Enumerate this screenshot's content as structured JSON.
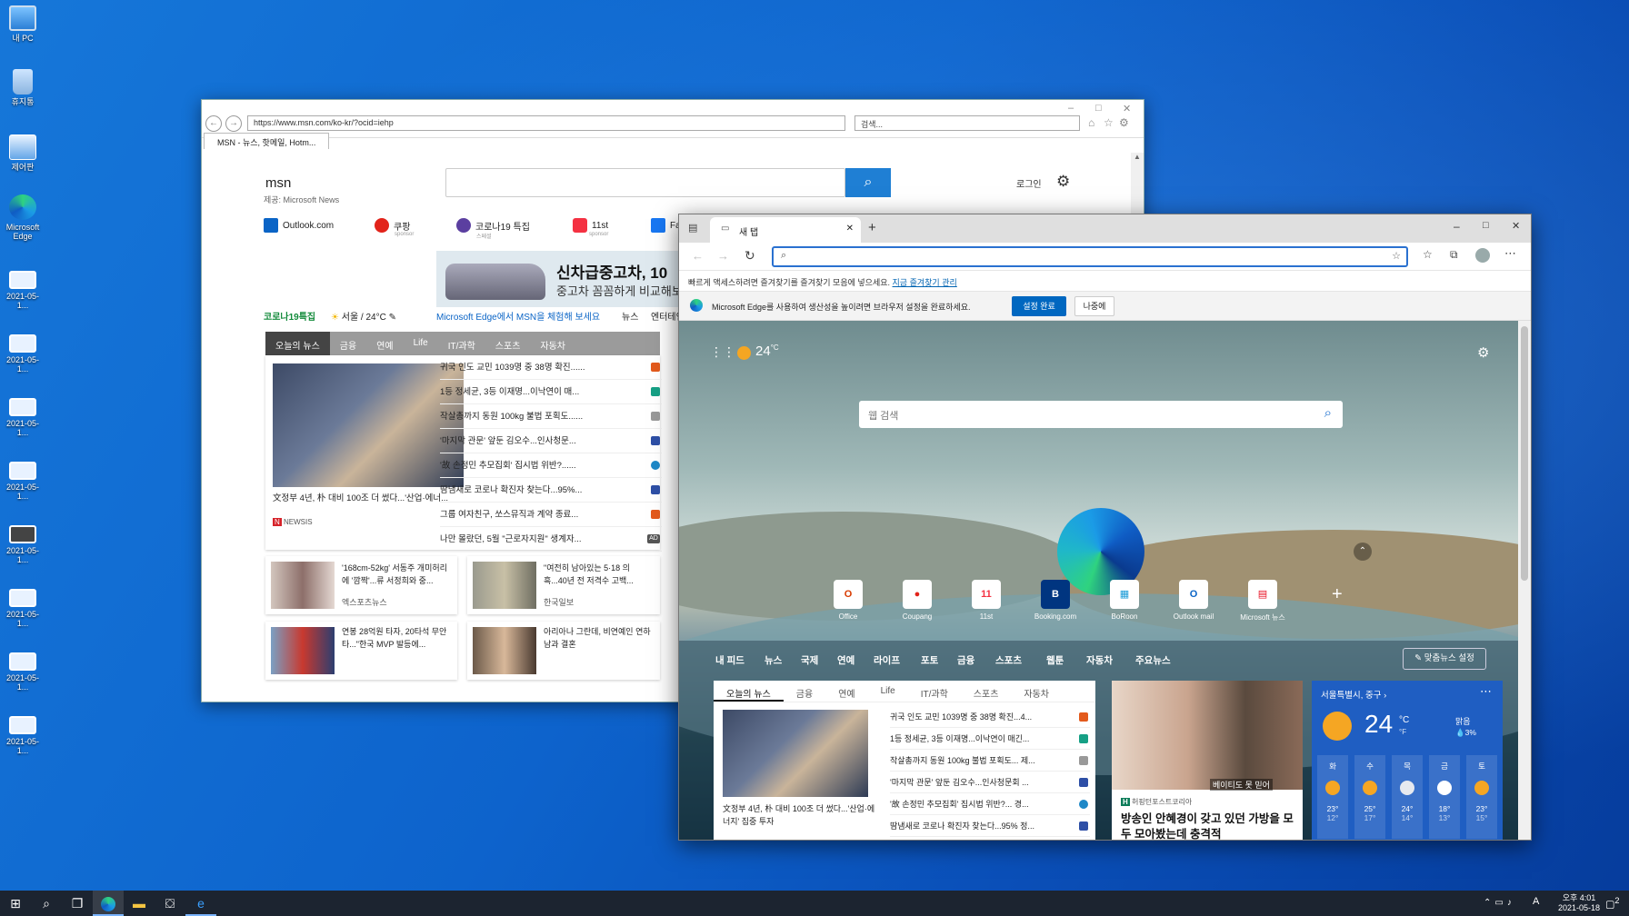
{
  "desktop": {
    "icons": [
      "내 PC",
      "휴지통",
      "제어판",
      "Microsoft Edge",
      "2021-05-1...",
      "2021-05-1...",
      "2021-05-1...",
      "2021-05-1...",
      "2021-05-1...",
      "2021-05-1...",
      "2021-05-1...",
      "2021-05-1..."
    ]
  },
  "ie": {
    "address": "https://www.msn.com/ko-kr/?ocid=iehp",
    "search_placeholder": "검색...",
    "tab_title": "MSN - 뉴스, 핫메일, Hotm...",
    "msn_logo": "msn",
    "msn_sub": "제공: Microsoft News",
    "login": "로그인",
    "quicklinks": [
      "Outlook.com",
      "쿠팡",
      "코로나19 특집",
      "11st",
      "Fa"
    ],
    "quick_sponsor": [
      "sponsor",
      "스페셜",
      "sponsor"
    ],
    "banner_title": "신차급중고차, 10",
    "banner_sub": "중고차 꼼꼼하게 비교해보",
    "covid": "코로나19특집",
    "weather": "서울 / 24°C",
    "edge_promo": "Microsoft Edge에서 MSN을 체험해 보세요",
    "subnav_news": "뉴스",
    "subnav_ent": "엔터테인",
    "tabs": [
      "오늘의 뉴스",
      "금융",
      "연예",
      "Life",
      "IT/과학",
      "스포츠",
      "자동차"
    ],
    "headline": "文정부 4년, 朴 대비 100조 더 썼다...'산업·에너...",
    "headline_source": "NEWSIS",
    "list": [
      "귀국 인도 교민 1039명 중 38명 확진......",
      "1등 정세균, 3등 이재명...이낙연이 매...",
      "작살총까지 동원 100kg 불법 포획도......",
      "'마지막 관문' 앞둔 김오수...인사청문...",
      "'故 손정민 추모집회' 집시법 위반?......",
      "땀냄새로 코로나 확진자 찾는다...95%...",
      "그룹 여자친구, 쏘스뮤직과 계약 종료...",
      "나만 몰랐던, 5월 \"근로자지원\" 생계자..."
    ],
    "ad_badge": "AD",
    "cards": [
      {
        "text": "'168cm-52kg' 서동주 개미허리에 '깜짝'...류 서정희와 중...",
        "source": "엑스포츠뉴스"
      },
      {
        "text": "\"여전히 남아있는 5·18 의 흑...40년 전 저격수 고백...",
        "source": "한국일보"
      },
      {
        "text": "연봉 28억원 타자, 20타석 무안타...\"한국 MVP 발등에...",
        "source": ""
      },
      {
        "text": "아리아나 그란데, 비연예인 연하남과 결혼",
        "source": ""
      }
    ]
  },
  "edge": {
    "tab_title": "새 탭",
    "fav_text": "빠르게 액세스하려면 즐겨찾기를 즐겨찾기 모음에 넣으세요.",
    "fav_link": "지금 즐겨찾기 관리",
    "info_text": "Microsoft Edge를 사용하여 생산성을 높이려면 브라우저 설정을 완료하세요.",
    "info_ok": "설정 완료",
    "info_later": "나중에",
    "temp": "24",
    "temp_unit": "°C",
    "search_placeholder": "웹 검색",
    "tiles": [
      "Office",
      "Coupang",
      "11st",
      "Booking.com",
      "BoRoon",
      "Outlook mail",
      "Microsoft 뉴스"
    ],
    "feed_tabs": [
      "내 피드",
      "뉴스",
      "국제",
      "연예",
      "라이프",
      "포토",
      "금융",
      "스포츠",
      "웹툰",
      "자동차",
      "주요뉴스"
    ],
    "personalize": "맞춤뉴스 설정",
    "news_tabs": [
      "오늘의 뉴스",
      "금융",
      "연예",
      "Life",
      "IT/과학",
      "스포츠",
      "자동차"
    ],
    "headline": "文정부 4년, 朴 대비 100조 더 썼다...'산업·에너지' 집중 투자",
    "list": [
      "귀국 인도 교민 1039명 중 38명 확진...4...",
      "1등 정세균, 3등 이재명...이낙연이 매긴...",
      "작살총까지 동원 100kg 불법 포획도... 제...",
      "'마지막 관문' 앞둔 김오수...인사청문회 ...",
      "'故 손정민 추모집회' 집시법 위반?... 경...",
      "땀냄새로 코로나 확진자 찾는다...95% 정..."
    ],
    "mid_source": "허핑턴포스트코리아",
    "mid_headline": "방송인 안혜경이 갖고 있던 가방을 모두 모아봤는데 충격적",
    "mid_caption": "베이티도 못 믿어",
    "weather": {
      "location": "서울특별시, 중구",
      "temp": "24",
      "unit": "°C",
      "unit2": "°F",
      "cond": "맑음",
      "precip": "3%",
      "days": [
        "화",
        "수",
        "목",
        "금",
        "토"
      ],
      "highs": [
        "23°",
        "25°",
        "24°",
        "18°",
        "23°"
      ],
      "lows": [
        "12°",
        "17°",
        "14°",
        "13°",
        "15°"
      ]
    }
  },
  "taskbar": {
    "time": "오후 4:01",
    "date": "2021-05-18",
    "ime": "A",
    "notif": "2"
  }
}
